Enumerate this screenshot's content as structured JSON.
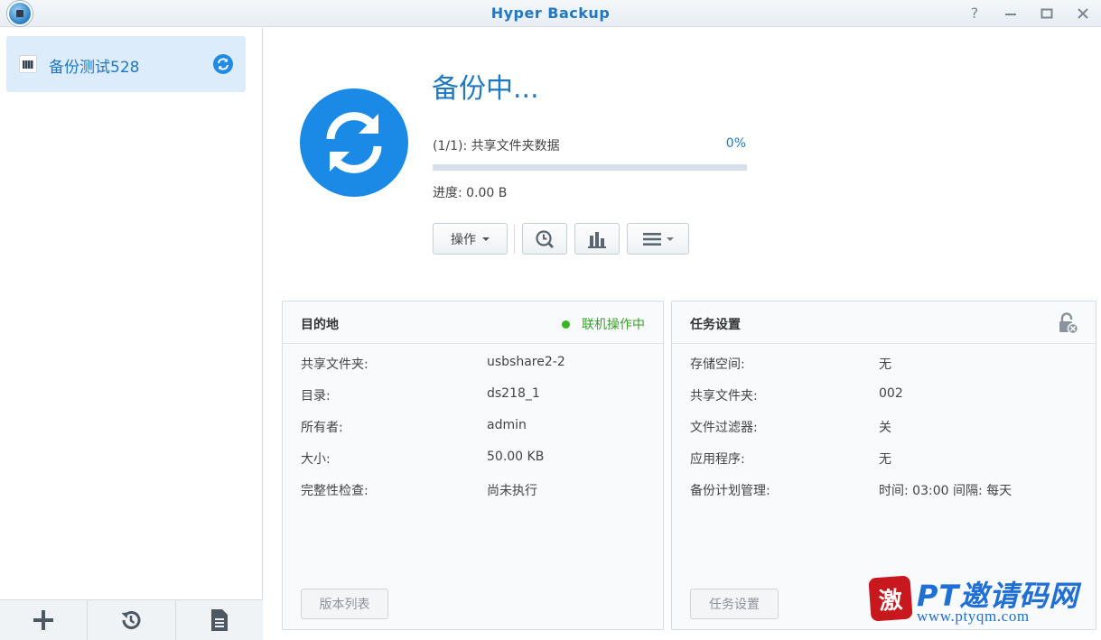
{
  "window": {
    "title": "Hyper Backup",
    "help": "?"
  },
  "sidebar": {
    "items": [
      {
        "label": "备份测试528",
        "status_icon": "sync-icon",
        "icon": "nas-device-icon"
      }
    ],
    "footer": [
      {
        "icon": "plus-icon"
      },
      {
        "icon": "restore-history-icon"
      },
      {
        "icon": "log-document-icon"
      }
    ]
  },
  "status": {
    "title": "备份中...",
    "progress_label": "(1/1): 共享文件夹数据",
    "progress_percent_text": "0%",
    "progress_fraction": 0,
    "progress_amount": "进度: 0.00 B"
  },
  "toolbar": {
    "action_label": "操作"
  },
  "destination": {
    "title": "目的地",
    "connection_status": "联机操作中",
    "rows": [
      {
        "key": "共享文件夹:",
        "value": "usbshare2-2"
      },
      {
        "key": "目录:",
        "value": "ds218_1"
      },
      {
        "key": "所有者:",
        "value": "admin"
      },
      {
        "key": "大小:",
        "value": "50.00 KB"
      },
      {
        "key": "完整性检查:",
        "value": "尚未执行"
      }
    ],
    "button_label": "版本列表"
  },
  "task_settings": {
    "title": "任务设置",
    "rows": [
      {
        "key": "存储空间:",
        "value": "无"
      },
      {
        "key": "共享文件夹:",
        "value": "002"
      },
      {
        "key": "文件过滤器:",
        "value": "关"
      },
      {
        "key": "应用程序:",
        "value": "无"
      },
      {
        "key": "备份计划管理:",
        "value": "时间: 03:00 间隔: 每天"
      }
    ],
    "button_label": "任务设置"
  },
  "watermark": {
    "seal_char": "激",
    "text": "PT邀请码网",
    "url": "www.ptyqm.com"
  },
  "colors": {
    "accent": "#1f78c1",
    "online": "#36b424",
    "progress_track": "#d7e0ea"
  }
}
